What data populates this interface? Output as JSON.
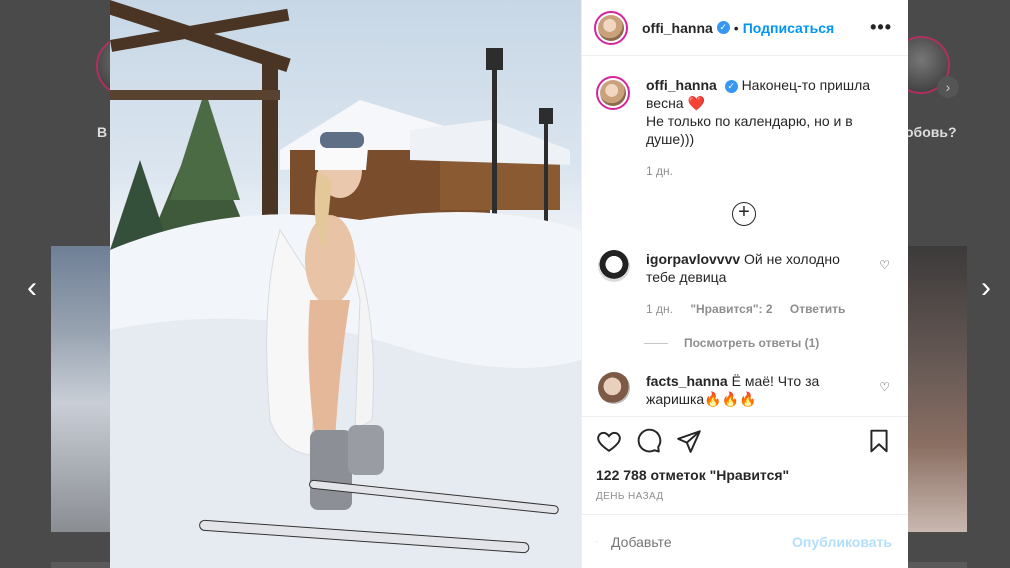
{
  "background": {
    "left_story_label": "В",
    "right_story_label": "обовь?"
  },
  "post": {
    "username": "offi_hanna",
    "follow_label": "Подписаться",
    "caption_line1": "Наконец-то пришла весна",
    "caption_line2": "Не только по календарю, но и в душе)))",
    "caption_emoji": "❤️",
    "caption_time": "1 дн.",
    "likes": "122 788 отметок \"Нравится\"",
    "posted_ago": "ДЕНЬ НАЗАД"
  },
  "comments": [
    {
      "username": "igorpavlovvvv",
      "text": "Ой не холодно тебе девица",
      "time": "1 дн.",
      "likes": "\"Нравится\": 2",
      "reply": "Ответить",
      "view_replies": "Посмотреть ответы (1)"
    },
    {
      "username": "facts_hanna",
      "text": "Ё маё! Что за жаришка🔥🔥🔥"
    }
  ],
  "add_comment": {
    "placeholder": "Добавьте",
    "publish_label": "Опубликовать"
  },
  "icons": {
    "more": "more-icon",
    "heart": "heart-icon",
    "comment": "comment-icon",
    "share": "share-icon",
    "save": "bookmark-icon",
    "emoji": "emoji-icon",
    "load_more": "plus-circle-icon"
  },
  "colors": {
    "accent": "#0095f6",
    "verified": "#3897f0",
    "publish_disabled": "#b2dffc"
  }
}
